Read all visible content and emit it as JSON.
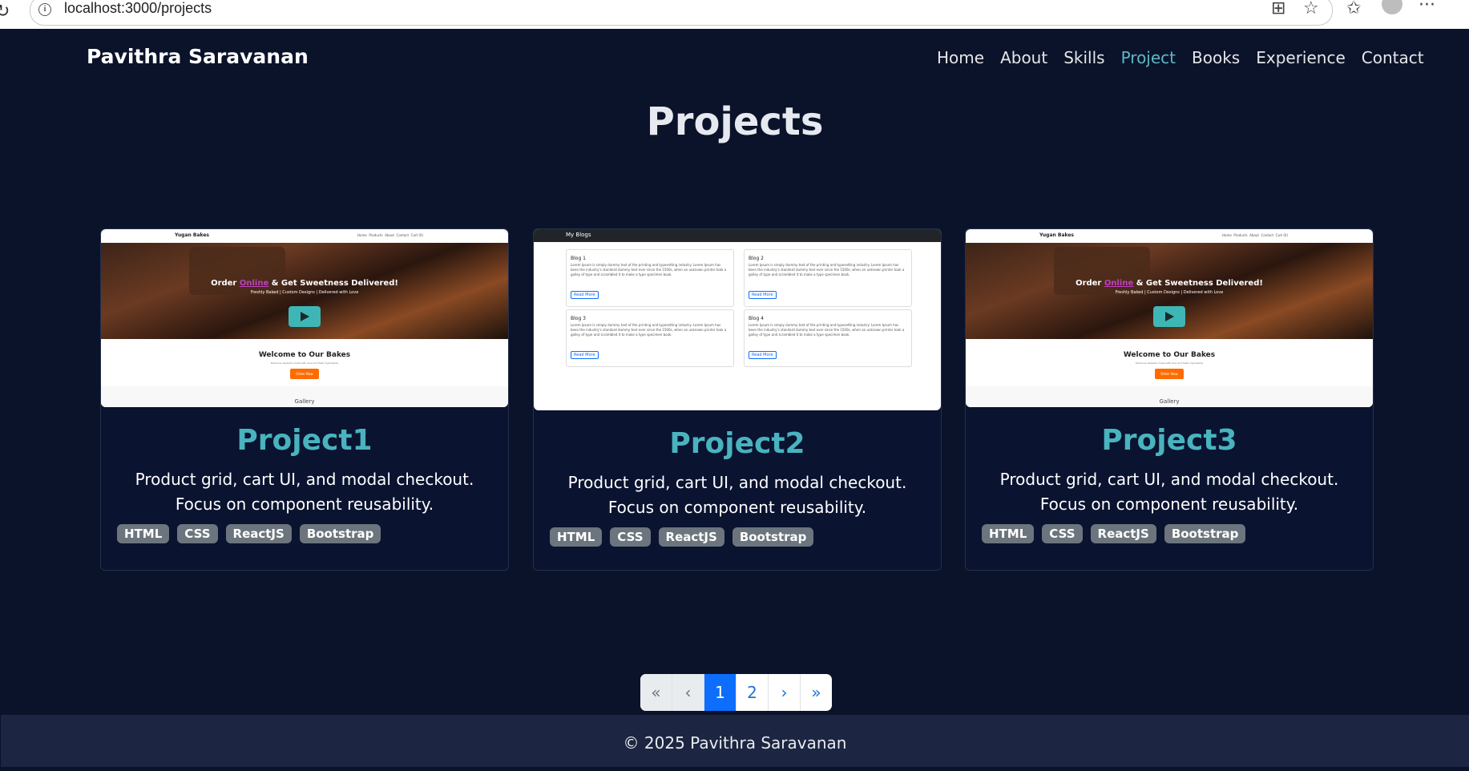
{
  "browser": {
    "url": "localhost:3000/projects"
  },
  "header": {
    "brand": "Pavithra Saravanan",
    "nav": [
      {
        "label": "Home",
        "active": false
      },
      {
        "label": "About",
        "active": false
      },
      {
        "label": "Skills",
        "active": false
      },
      {
        "label": "Project",
        "active": true
      },
      {
        "label": "Books",
        "active": false
      },
      {
        "label": "Experience",
        "active": false
      },
      {
        "label": "Contact",
        "active": false
      }
    ]
  },
  "main": {
    "title": "Projects",
    "projects": [
      {
        "title": "Project1",
        "description": "Product grid, cart UI, and modal checkout. Focus on component reusability.",
        "tags": [
          "HTML",
          "CSS",
          "ReactJS",
          "Bootstrap"
        ],
        "preview": {
          "site_name": "Yugan Bakes",
          "nav": "Home  Products  About  Contact  Cart (0)",
          "hero_line1": "Order",
          "hero_highlight": "Online",
          "hero_line2": "& Get Sweetness Delivered!",
          "hero_sub": "Freshly Baked | Custom Designs | Delivered with Love",
          "welcome": "Welcome to Our Bakes",
          "welcome_sub": "Delicious desserts made with love and fresh ingredients",
          "order_button": "Order Now",
          "gallery": "Gallery"
        }
      },
      {
        "title": "Project2",
        "description": "Product grid, cart UI, and modal checkout. Focus on component reusability.",
        "tags": [
          "HTML",
          "CSS",
          "ReactJS",
          "Bootstrap"
        ],
        "preview": {
          "site_name": "My Blogs",
          "blogs": [
            "Blog 1",
            "Blog 2",
            "Blog 3",
            "Blog 4"
          ],
          "blog_text": "Lorem Ipsum is simply dummy text of the printing and typesetting industry. Lorem Ipsum has been the industry's standard dummy text ever since the 1500s, when an unknown printer took a galley of type and scrambled it to make a type specimen book.",
          "read_more": "Read More"
        }
      },
      {
        "title": "Project3",
        "description": "Product grid, cart UI, and modal checkout. Focus on component reusability.",
        "tags": [
          "HTML",
          "CSS",
          "ReactJS",
          "Bootstrap"
        ],
        "preview": {
          "site_name": "Yugan Bakes",
          "nav": "Home  Products  About  Contact  Cart (0)",
          "hero_line1": "Order",
          "hero_highlight": "Online",
          "hero_line2": "& Get Sweetness Delivered!",
          "hero_sub": "Freshly Baked | Custom Designs | Delivered with Love",
          "welcome": "Welcome to Our Bakes",
          "welcome_sub": "Delicious desserts made with love and fresh ingredients",
          "order_button": "Order Now",
          "gallery": "Gallery"
        }
      }
    ]
  },
  "pagination": {
    "first": "«",
    "prev": "‹",
    "pages": [
      "1",
      "2"
    ],
    "current": "1",
    "next": "›",
    "last": "»"
  },
  "footer": {
    "text": "© 2025 Pavithra Saravanan"
  }
}
